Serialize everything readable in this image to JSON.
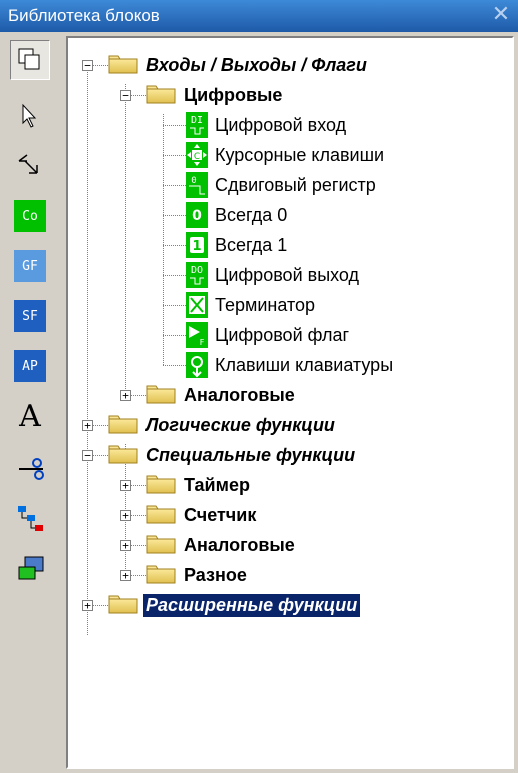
{
  "window": {
    "title": "Библиотека блоков",
    "close_glyph": "✕"
  },
  "toolbar": {
    "items": [
      {
        "name": "view-toggle-icon"
      },
      {
        "name": "pointer-icon"
      },
      {
        "name": "connector-icon"
      },
      {
        "name": "co-icon",
        "text": "Co",
        "color": "#00c000"
      },
      {
        "name": "gf-icon",
        "text": "GF",
        "color": "#5a9be0"
      },
      {
        "name": "sf-icon",
        "text": "SF",
        "color": "#1e5fc0"
      },
      {
        "name": "ap-icon",
        "text": "AP",
        "color": "#1e5fc0"
      },
      {
        "name": "text-icon",
        "text": "A"
      },
      {
        "name": "cut-icon"
      },
      {
        "name": "tree-icon"
      },
      {
        "name": "network-icon"
      }
    ]
  },
  "tree": {
    "io_flags": "Входы / Выходы / Флаги",
    "digital": "Цифровые",
    "digital_items": [
      {
        "label": "Цифровой вход",
        "icon": "DI"
      },
      {
        "label": "Курсорные клавиши",
        "icon": "C"
      },
      {
        "label": "Сдвиговый регистр",
        "icon": "S"
      },
      {
        "label": "Всегда 0",
        "icon": "0"
      },
      {
        "label": "Всегда 1",
        "icon": "1"
      },
      {
        "label": "Цифровой выход",
        "icon": "DO"
      },
      {
        "label": "Терминатор",
        "icon": "X"
      },
      {
        "label": "Цифровой флаг",
        "icon": "F"
      },
      {
        "label": "Клавиши клавиатуры",
        "icon": "K"
      }
    ],
    "analog1": "Аналоговые",
    "logic": "Логические функции",
    "special": "Специальные функции",
    "timer": "Таймер",
    "counter": "Счетчик",
    "analog2": "Аналоговые",
    "misc": "Разное",
    "advanced": "Расширенные функции",
    "expand_glyph": "+",
    "collapse_glyph": "−"
  },
  "colors": {
    "accent": "#0a246a",
    "icon_green": "#00c000",
    "folder": "#f0d878"
  }
}
